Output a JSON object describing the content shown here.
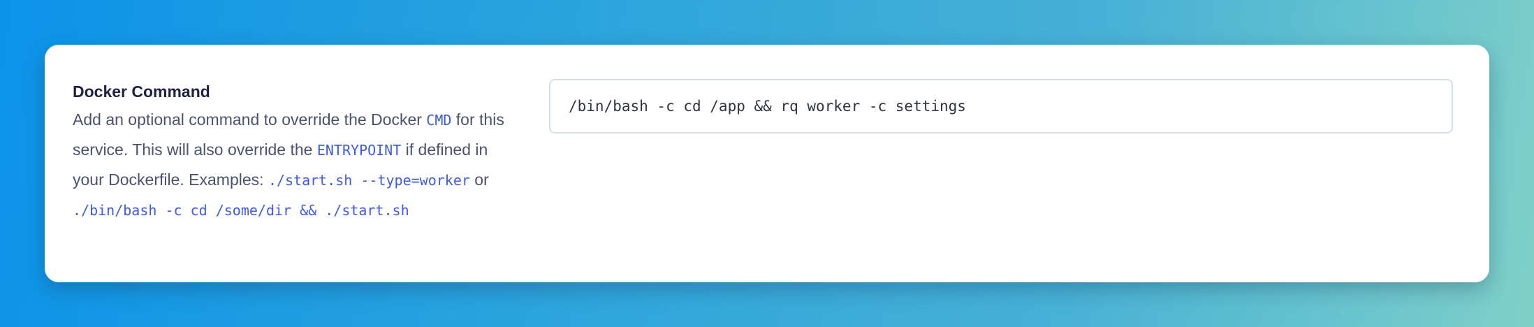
{
  "setting": {
    "title": "Docker Command",
    "description": {
      "part1": "Add an optional command to override the Docker ",
      "code1": "CMD",
      "part2": " for this service. This will also override the ",
      "code2": "ENTRYPOINT",
      "part3": " if defined in your Dockerfile. Examples: ",
      "code3": "./start.sh --type=worker",
      "part4": " or ",
      "code4": "./bin/bash -c cd /some/dir && ./start.sh"
    }
  },
  "input": {
    "value": "/bin/bash -c cd /app && rq worker -c settings"
  },
  "colors": {
    "code_accent": "#3e5be0",
    "title": "#1f2340",
    "body_text": "#4b5270"
  }
}
